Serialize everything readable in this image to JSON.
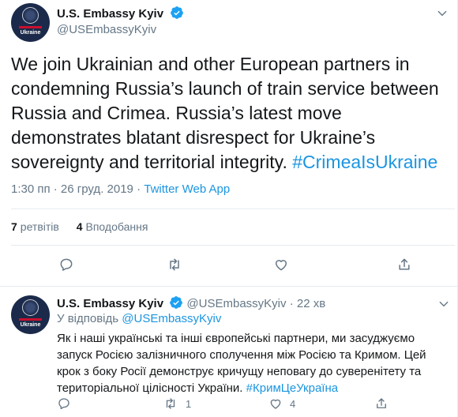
{
  "main_tweet": {
    "author_name": "U.S. Embassy Kyiv",
    "author_handle": "@USEmbassyKyiv",
    "avatar_label": "Ukraine",
    "text": "We join Ukrainian and other European partners in condemning Russia’s launch of train service between Russia and Crimea. Russia’s latest move demonstrates blatant disrespect for Ukraine’s sovereignty and territorial integrity. ",
    "hashtag": "#CrimeaIsUkraine",
    "time": "1:30 пп · 26 груд. 2019",
    "dot": " · ",
    "via": "Twitter Web App",
    "retweets_count": "7",
    "retweets_label": "ретвітів",
    "likes_count": "4",
    "likes_label": "Вподобання"
  },
  "reply": {
    "author_name": "U.S. Embassy Kyiv",
    "author_handle": "@USEmbassyKyiv",
    "separator": "·",
    "time_ago": "22 хв",
    "avatar_label": "Ukraine",
    "replying_to_label": "У відповідь",
    "replying_to_handle": "@USEmbassyKyiv",
    "text": "Як і наші українські та інші європейські партнери, ми засуджуємо запуск Росією залізничного сполучення між Росією та Кримом. Цей крок з боку Росії демонструє кричущу неповагу до суверенітету та територіальної цілісності України. ",
    "hashtag": "#КримЦеУкраїна",
    "retweet_count": "1",
    "like_count": "4"
  },
  "colors": {
    "accent": "#1b95e0",
    "muted": "#657786",
    "text": "#14171a",
    "border": "#e6ecf0"
  }
}
